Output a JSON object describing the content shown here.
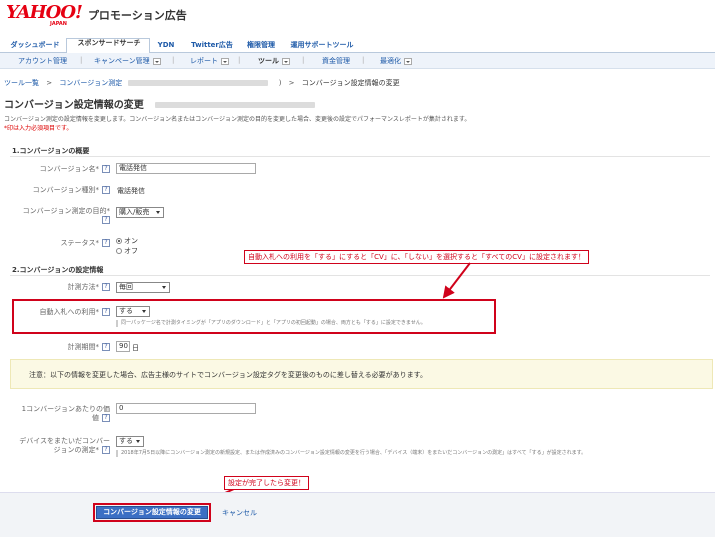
{
  "header": {
    "logo_main": "YAHOO!",
    "logo_sub": "JAPAN",
    "title": "プロモーション広告"
  },
  "main_tabs": [
    {
      "label": "ダッシュボード"
    },
    {
      "label": "スポンサードサーチ"
    },
    {
      "label": "YDN"
    },
    {
      "label": "Twitter広告"
    },
    {
      "label": "権限管理"
    },
    {
      "label": "運用サポートツール"
    }
  ],
  "sub_nav": [
    {
      "label": "アカウント管理"
    },
    {
      "label": "キャンペーン管理"
    },
    {
      "label": "レポート"
    },
    {
      "label": "ツール"
    },
    {
      "label": "資金管理"
    },
    {
      "label": "最適化"
    }
  ],
  "breadcrumb": {
    "item1": "ツール一覧",
    "item2": "コンバージョン測定",
    "current": "コンバージョン設定情報の変更",
    "sep": ">",
    "close": ")"
  },
  "page_title": "コンバージョン設定情報の変更",
  "description": "コンバージョン測定の設定情報を変更します。コンバージョン名またはコンバージョン測定の目的を変更した場合、変更後の設定でパフォーマンスレポートが集計されます。",
  "required_note": "*印は入力必須項目です。",
  "section1": {
    "heading": "1.コンバージョンの概要",
    "name_label": "コンバージョン名*",
    "name_value": "電話発信",
    "type_label": "コンバージョン種別*",
    "type_value": "電話発信",
    "purpose_label": "コンバージョン測定の目的*",
    "purpose_value": "購入/販売",
    "status_label": "ステータス*",
    "status_on": "オン",
    "status_off": "オフ"
  },
  "section2": {
    "heading": "2.コンバージョンの設定情報",
    "method_label": "計測方法*",
    "method_value": "毎回",
    "autobid_label": "自動入札への利用*",
    "autobid_value": "する",
    "autobid_note": "同一パッケージ名で計測タイミングが「アプリのダウンロード」と「アプリの初回起動」の場合、両方とも「する」に設定できません。",
    "period_label": "計測期間*",
    "period_value": "90",
    "period_unit": "日"
  },
  "warning": "注意：以下の情報を変更した場合、広告主様のサイトでコンバージョン設定タグを変更後のものに差し替える必要があります。",
  "value_field": {
    "label1": "1コンバージョンあたりの価",
    "label2": "値",
    "value": "0"
  },
  "cross_device": {
    "label1": "デバイスをまたいだコンバー",
    "label2": "ジョンの測定*",
    "value": "する",
    "note": "2018年7月5日以降にコンバージョン測定の新規設定、または作成済みのコンバージョン設定情報の変更を行う場合、「デバイス（端末）をまたいだコンバージョンの測定」はすべて「する」が設定されます。"
  },
  "callouts": {
    "autobid": "自動入札への利用を「する」にすると「CV」に、「しない」を選択すると「すべてのCV」に設定されます！",
    "submit": "設定が完了したら変更！"
  },
  "footer": {
    "submit_label": "コンバージョン設定情報の変更",
    "cancel_label": "キャンセル"
  },
  "help_mark": "?",
  "colors": {
    "accent": "#1e5aa8",
    "callout_red": "#d0021b",
    "button_blue": "#3b6fc4",
    "warning_bg": "#fbf9e4"
  }
}
